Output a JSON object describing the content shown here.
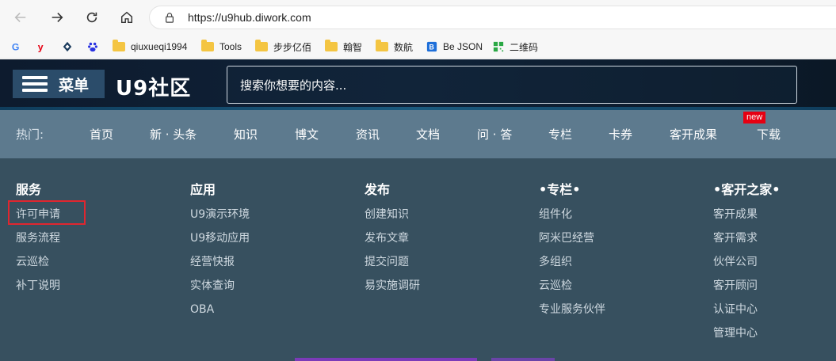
{
  "browser": {
    "url": "https://u9hub.diwork.com"
  },
  "bookmarks": [
    {
      "label": "",
      "icon": "google-icon"
    },
    {
      "label": "",
      "icon": "yonyou-icon"
    },
    {
      "label": "",
      "icon": "diamond-icon"
    },
    {
      "label": "",
      "icon": "baidu-icon"
    },
    {
      "label": "qiuxueqi1994",
      "icon": "folder-icon"
    },
    {
      "label": "Tools",
      "icon": "folder-icon"
    },
    {
      "label": "步步亿佰",
      "icon": "folder-icon"
    },
    {
      "label": "翰智",
      "icon": "folder-icon"
    },
    {
      "label": "数航",
      "icon": "folder-icon"
    },
    {
      "label": "Be JSON",
      "icon": "bejson-icon"
    },
    {
      "label": "二维码",
      "icon": "qrcode-icon"
    }
  ],
  "header": {
    "menu_label": "菜单",
    "logo": "U9社区",
    "search_placeholder": "搜索你想要的内容..."
  },
  "hot_nav": {
    "label": "热门:",
    "items": [
      "首页",
      "新 · 头条",
      "知识",
      "博文",
      "资讯",
      "文档",
      "问 · 答",
      "专栏",
      "卡券",
      "客开成果",
      "下载"
    ],
    "badge": "new"
  },
  "mega_menu": {
    "columns": [
      {
        "title": "服务",
        "items": [
          "许可申请",
          "服务流程",
          "云巡检",
          "补丁说明"
        ]
      },
      {
        "title": "应用",
        "items": [
          "U9演示环境",
          "U9移动应用",
          "经营快报",
          "实体查询",
          "OBA"
        ]
      },
      {
        "title": "发布",
        "items": [
          "创建知识",
          "发布文章",
          "提交问题",
          "易实施调研"
        ]
      },
      {
        "title": "•专栏•",
        "items": [
          "组件化",
          "阿米巴经营",
          "多组织",
          "云巡检",
          "专业服务伙伴"
        ]
      },
      {
        "title": "•客开之家•",
        "items": [
          "客开成果",
          "客开需求",
          "伙伴公司",
          "客开顾问",
          "认证中心",
          "管理中心"
        ]
      }
    ]
  },
  "colors": {
    "header_bg": "#0f2238",
    "hot_nav_bg": "#5d7a8e",
    "mega_bg": "#37505f",
    "highlight": "#e0262f"
  }
}
